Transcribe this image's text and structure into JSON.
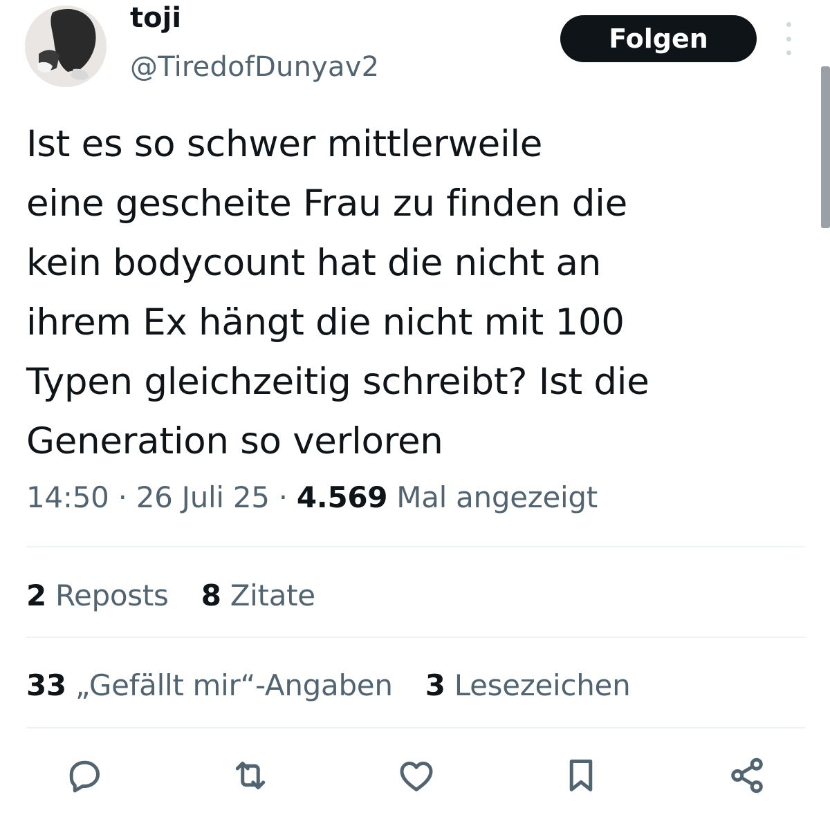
{
  "author": {
    "display_name": "toji",
    "handle": "@TiredofDunyav2"
  },
  "follow_button": {
    "label": "Folgen"
  },
  "tweet": {
    "lines": [
      "Ist es so schwer mittlerweile",
      "eine gescheite Frau zu finden die",
      "kein bodycount hat die nicht an",
      "ihrem Ex hängt die nicht mit 100",
      "Typen gleichzeitig schreibt? Ist die",
      "Generation so verloren"
    ]
  },
  "meta": {
    "time": "14:50",
    "separator": "·",
    "date": "26 Juli 25",
    "views_count": "4.569",
    "views_label": "Mal angezeigt"
  },
  "stats": {
    "reposts_count": "2",
    "reposts_label": "Reposts",
    "quotes_count": "8",
    "quotes_label": "Zitate",
    "likes_count": "33",
    "likes_label": "„Gefällt mir“-Angaben",
    "bookmarks_count": "3",
    "bookmarks_label": "Lesezeichen"
  },
  "actions": [
    "reply-icon",
    "repost-icon",
    "like-icon",
    "bookmark-icon",
    "share-icon"
  ],
  "colors": {
    "text_primary": "#0f1419",
    "text_secondary": "#536471",
    "button_bg": "#0f1419",
    "divider": "#eff3f4"
  }
}
